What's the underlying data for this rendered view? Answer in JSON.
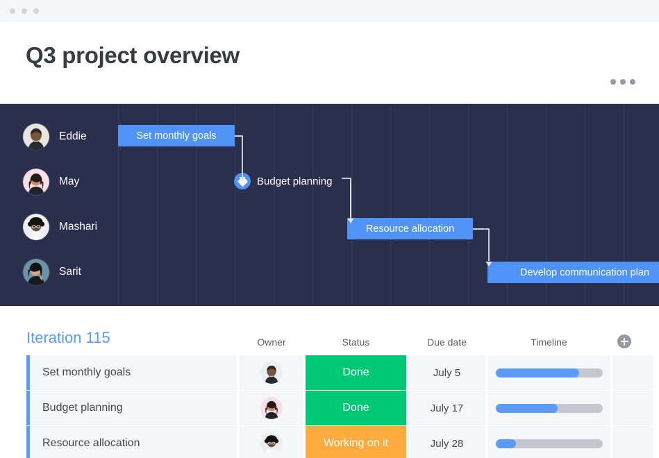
{
  "window": {
    "traffic_lights": [
      "close",
      "minimize",
      "maximize"
    ]
  },
  "header": {
    "title": "Q3 project overview",
    "more_menu": "more-options"
  },
  "gantt": {
    "background_color": "#2b2f4e",
    "bar_color": "#4f93f7",
    "people": [
      {
        "name": "Eddie",
        "avatar": "avatar-eddie"
      },
      {
        "name": "May",
        "avatar": "avatar-may"
      },
      {
        "name": "Mashari",
        "avatar": "avatar-mashari"
      },
      {
        "name": "Sarit",
        "avatar": "avatar-sarit"
      }
    ],
    "items": [
      {
        "label": "Set monthly goals",
        "type": "bar"
      },
      {
        "label": "Budget planning",
        "type": "milestone"
      },
      {
        "label": "Resource allocation",
        "type": "bar"
      },
      {
        "label": "Develop communication plan",
        "type": "bar"
      }
    ]
  },
  "board": {
    "group_title": "Iteration 115",
    "group_color": "#5b9bf8",
    "columns": [
      "Owner",
      "Status",
      "Due date",
      "Timeline"
    ],
    "add_column_label": "+",
    "status_colors": {
      "done": "#00c875",
      "working": "#fdab3d"
    },
    "rows": [
      {
        "name": "Set monthly goals",
        "owner": "Eddie",
        "owner_avatar": "avatar-eddie",
        "status": "Done",
        "status_key": "done",
        "due_date": "July 5",
        "timeline_percent": 78
      },
      {
        "name": "Budget planning",
        "owner": "May",
        "owner_avatar": "avatar-may",
        "status": "Done",
        "status_key": "done",
        "due_date": "July 17",
        "timeline_percent": 58
      },
      {
        "name": "Resource allocation",
        "owner": "Mashari",
        "owner_avatar": "avatar-mashari",
        "status": "Working on it",
        "status_key": "working",
        "due_date": "July 28",
        "timeline_percent": 19
      }
    ]
  }
}
